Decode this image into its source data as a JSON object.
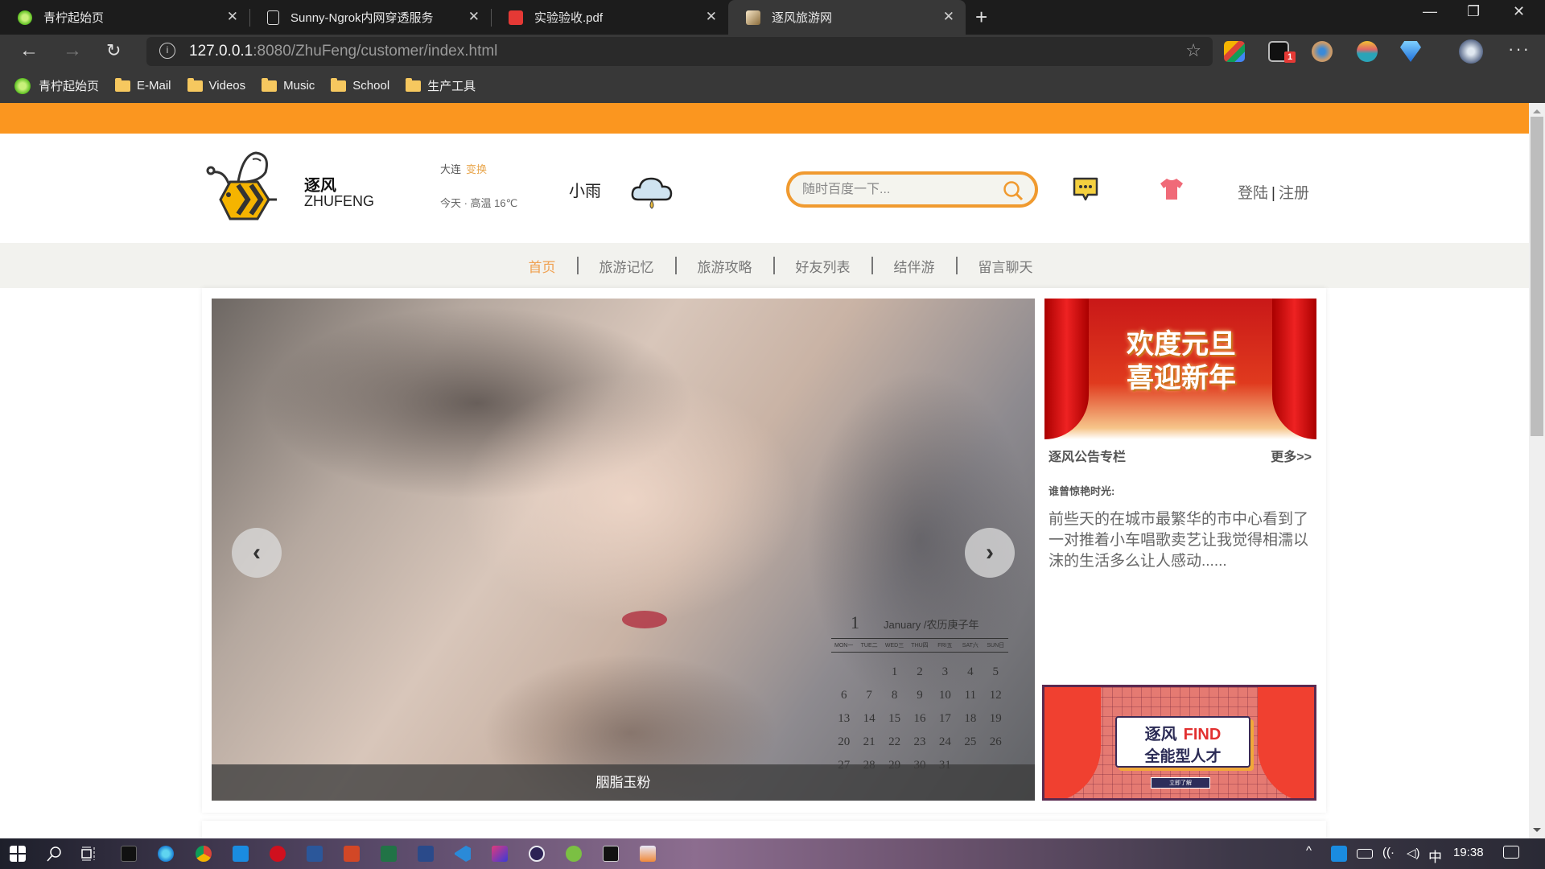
{
  "browser": {
    "tabs": [
      {
        "title": "青柠起始页",
        "icon": "lime-icon",
        "active": false
      },
      {
        "title": "Sunny-Ngrok内网穿透服务",
        "icon": "page-icon",
        "active": false
      },
      {
        "title": "实验验收.pdf",
        "icon": "pdf-icon",
        "active": false
      },
      {
        "title": "逐风旅游网",
        "icon": "site-icon",
        "active": true
      }
    ],
    "new_tab": "+",
    "window_controls": {
      "minimize": "—",
      "restore": "❐",
      "close": "✕"
    },
    "url_host": "127.0.0.1",
    "url_rest": ":8080/ZhuFeng/customer/index.html",
    "extension_badge": "1",
    "more": "···",
    "bookmarks": [
      {
        "label": "青柠起始页",
        "icon": "lime-icon"
      },
      {
        "label": "E-Mail",
        "icon": "folder-icon"
      },
      {
        "label": "Videos",
        "icon": "folder-icon"
      },
      {
        "label": "Music",
        "icon": "folder-icon"
      },
      {
        "label": "School",
        "icon": "folder-icon"
      },
      {
        "label": "生产工具",
        "icon": "folder-icon"
      }
    ]
  },
  "site": {
    "colors": {
      "accent": "#fb961f",
      "nav_active": "#f0a050",
      "nav_bg": "#f2f2ee"
    },
    "brand_cn": "逐风",
    "brand_en": "ZHUFENG",
    "city": "大连",
    "change_city": "变换",
    "temperature": "今天 · 高温 16℃",
    "weather": "小雨",
    "search_placeholder": "随时百度一下...",
    "login": "登陆",
    "auth_sep": "|",
    "register": "注册",
    "nav": [
      {
        "label": "首页",
        "active": true
      },
      {
        "label": "旅游记忆",
        "active": false
      },
      {
        "label": "旅游攻略",
        "active": false
      },
      {
        "label": "好友列表",
        "active": false
      },
      {
        "label": "结伴游",
        "active": false
      },
      {
        "label": "留言聊天",
        "active": false
      }
    ],
    "carousel": {
      "caption": "胭脂玉粉",
      "prev": "‹",
      "next": "›",
      "calendar": {
        "day": "1",
        "month": "January /农历庚子年",
        "weekdays": [
          "MON一",
          "TUE二",
          "WED三",
          "THU四",
          "FRI五",
          "SAT六",
          "SUN日"
        ],
        "days": [
          "",
          "",
          "1",
          "2",
          "3",
          "4",
          "5",
          "6",
          "7",
          "8",
          "9",
          "10",
          "11",
          "12",
          "13",
          "14",
          "15",
          "16",
          "17",
          "18",
          "19",
          "20",
          "21",
          "22",
          "23",
          "24",
          "25",
          "26",
          "27",
          "28",
          "29",
          "30",
          "31",
          "",
          ""
        ]
      }
    },
    "banner1_line1": "欢度元旦",
    "banner1_line2": "喜迎新年",
    "announcement": {
      "title": "逐风公告专栏",
      "more": "更多>>",
      "subtitle": "谁曾惊艳时光:",
      "body": "前些天的在城市最繁华的市中心看到了一对推着小车唱歌卖艺让我觉得相濡以沫的生活多么让人感动......"
    },
    "banner2": {
      "line1_cn": "逐风",
      "line1_en": "FIND",
      "line2": "全能型人才",
      "button": "立即了解"
    }
  },
  "taskbar": {
    "clock": "19:38",
    "ime": "中",
    "tray_chevron": "^"
  }
}
